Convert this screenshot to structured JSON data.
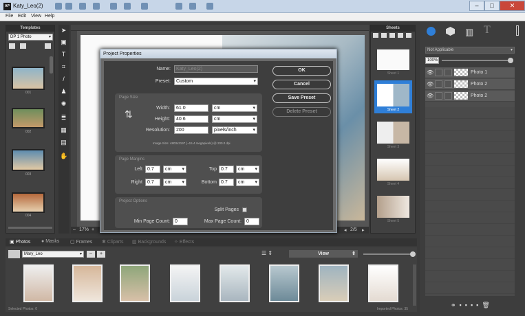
{
  "window": {
    "title": "Katy_Leo(2)",
    "logo": "AP"
  },
  "menu": [
    "File",
    "Edit",
    "View",
    "Help"
  ],
  "templates": {
    "header": "Templates",
    "selected": "DP 1 Photo",
    "items": [
      "001",
      "002",
      "003",
      "004"
    ]
  },
  "canvas": {
    "zoom": "17%",
    "page": "2/5"
  },
  "sheets": {
    "header": "Sheets",
    "items": [
      "Sheet 1",
      "Sheet 2",
      "Sheet 3",
      "Sheet 4",
      "Sheet 5"
    ]
  },
  "right": {
    "blend": "Not Applicable",
    "opacity": "100%",
    "layers": [
      "Photo 1",
      "Photo 2",
      "Photo 2"
    ]
  },
  "bottom": {
    "tabs": [
      "Photos",
      "Masks",
      "Frames",
      "Cliparts",
      "Backgrounds",
      "Effects"
    ],
    "album": "Mary_Leo",
    "view": "View",
    "selected_status": "Selected Photos: 0",
    "imported_status": "Imported Photos: 35"
  },
  "dialog": {
    "title": "Project Properties",
    "name_label": "Name:",
    "name_value": "Katy_Leo(2)",
    "preset_label": "Preset:",
    "preset_value": "Custom",
    "page_size_title": "Page Size",
    "width_label": "Width:",
    "width_value": "61.0",
    "width_unit": "cm",
    "height_label": "Height:",
    "height_value": "40.6",
    "height_unit": "cm",
    "res_label": "Resolution:",
    "res_value": "200",
    "res_unit": "pixels/inch",
    "image_size": "Image Size: 4803x3197 (~15.4 megapixels) @ 200.0 dpi",
    "margins_title": "Page Margins",
    "left_label": "Left",
    "left_value": "0.7",
    "top_label": "Top",
    "top_value": "0.7",
    "right_label": "Right",
    "right_value": "0.7",
    "bottom_label": "Bottom",
    "bottom_value": "0.7",
    "margin_unit": "cm",
    "options_title": "Project Options",
    "split_label": "Split Pages",
    "min_label": "Min Page Count:",
    "min_value": "0",
    "max_label": "Max Page Count:",
    "max_value": "0",
    "ok": "OK",
    "cancel": "Cancel",
    "save_preset": "Save Preset",
    "delete_preset": "Delete Preset"
  }
}
